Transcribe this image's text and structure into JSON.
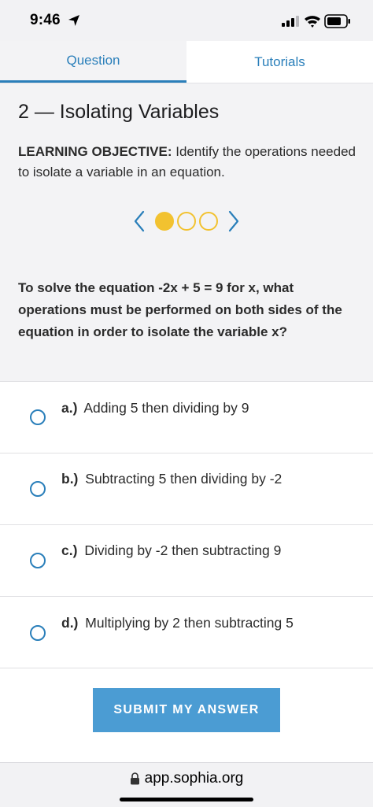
{
  "status_bar": {
    "time": "9:46"
  },
  "tabs": [
    {
      "label": "Question",
      "active": true
    },
    {
      "label": "Tutorials",
      "active": false
    }
  ],
  "lesson": {
    "title": "2 — Isolating Variables",
    "objective_label": "LEARNING OBJECTIVE:",
    "objective_text": " Identify the operations needed to isolate a variable in an equation."
  },
  "pager": {
    "total": 3,
    "current": 1
  },
  "question": "To solve the equation -2x + 5 = 9 for x, what operations must be performed on both sides of the equation in order to isolate the variable x?",
  "options": [
    {
      "letter": "a.)",
      "text": "Adding 5 then dividing by 9"
    },
    {
      "letter": "b.)",
      "text": "Subtracting 5 then dividing by -2"
    },
    {
      "letter": "c.)",
      "text": "Dividing by -2 then subtracting 9"
    },
    {
      "letter": "d.)",
      "text": "Multiplying by 2 then subtracting 5"
    }
  ],
  "submit_label": "SUBMIT MY ANSWER",
  "browser": {
    "url": "app.sophia.org"
  },
  "colors": {
    "accent": "#2a7fba",
    "button": "#4b9cd3",
    "pager_dot": "#f2c230",
    "background": "#f3f3f5"
  }
}
